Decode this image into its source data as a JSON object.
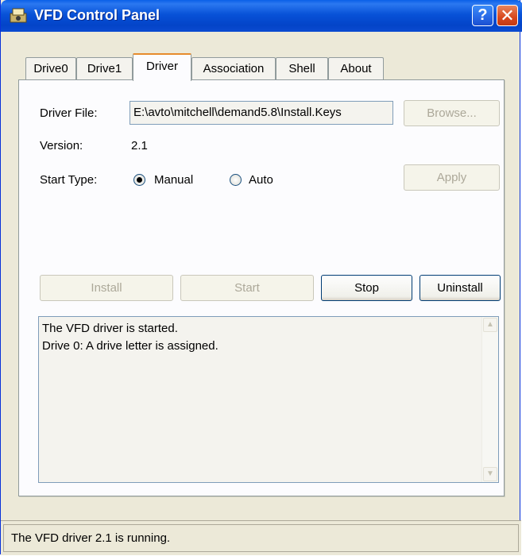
{
  "window": {
    "title": "VFD Control Panel",
    "help_button": "?",
    "close_button": "✕"
  },
  "tabs": [
    {
      "label": "Drive0",
      "active": false
    },
    {
      "label": "Drive1",
      "active": false
    },
    {
      "label": "Driver",
      "active": true
    },
    {
      "label": "Association",
      "active": false
    },
    {
      "label": "Shell",
      "active": false
    },
    {
      "label": "About",
      "active": false
    }
  ],
  "driver": {
    "file_label": "Driver File:",
    "file_value": "E:\\avto\\mitchell\\demand5.8\\Install.Keys",
    "browse_label": "Browse...",
    "version_label": "Version:",
    "version_value": "2.1",
    "start_type_label": "Start Type:",
    "manual_label": "Manual",
    "auto_label": "Auto",
    "selected_start_type": "Manual",
    "apply_label": "Apply"
  },
  "actions": {
    "install": "Install",
    "start": "Start",
    "stop": "Stop",
    "uninstall": "Uninstall"
  },
  "log": {
    "line1": "The VFD driver is started.",
    "line2": "Drive 0: A drive letter is assigned."
  },
  "status": {
    "text": "The VFD driver 2.1 is running."
  }
}
